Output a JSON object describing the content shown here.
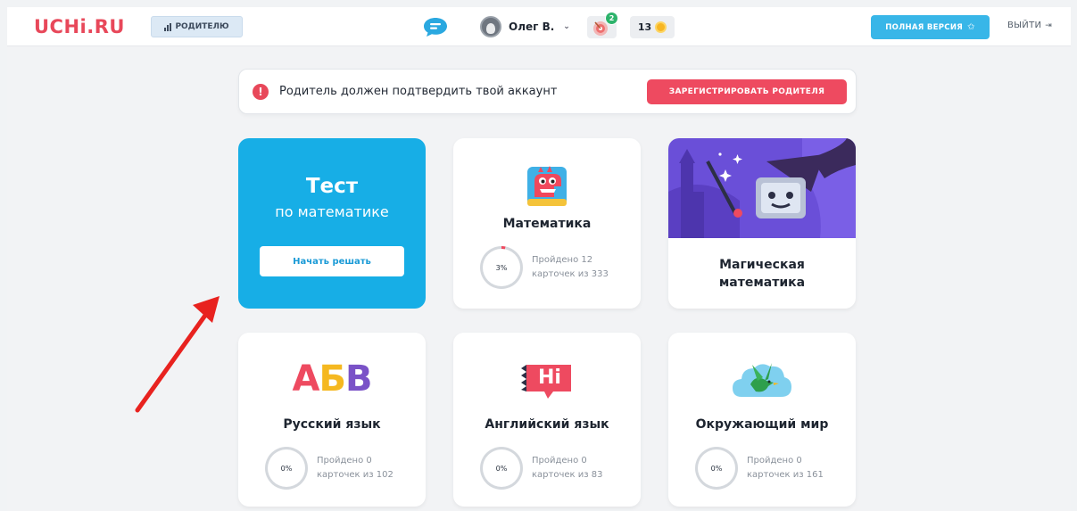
{
  "header": {
    "logo": "UCHi.RU",
    "parent_label": "РОДИТЕЛЮ",
    "user_name": "Олег В.",
    "notifications_count": "2",
    "coins": "13",
    "full_version_label": "ПОЛНАЯ ВЕРСИЯ",
    "logout_label": "ВЫЙТИ"
  },
  "alert": {
    "text": "Родитель должен подтвердить твой аккаунт",
    "button_label": "ЗАРЕГИСТРИРОВАТЬ РОДИТЕЛЯ"
  },
  "test_card": {
    "title": "Тест",
    "subtitle": "по математике",
    "button_label": "Начать решать"
  },
  "subjects": [
    {
      "title": "Математика",
      "percent_label": "3%",
      "percent": 3,
      "progress_line1": "Пройдено 12",
      "progress_line2": "карточек из 333"
    },
    {
      "title": "Русский язык",
      "percent_label": "0%",
      "percent": 0,
      "progress_line1": "Пройдено 0",
      "progress_line2": "карточек из 102"
    },
    {
      "title": "Английский язык",
      "percent_label": "0%",
      "percent": 0,
      "progress_line1": "Пройдено 0",
      "progress_line2": "карточек из 83"
    },
    {
      "title": "Окружающий мир",
      "percent_label": "0%",
      "percent": 0,
      "progress_line1": "Пройдено 0",
      "progress_line2": "карточек из 161"
    }
  ],
  "magic_card": {
    "title_line1": "Магическая",
    "title_line2": "математика"
  },
  "icons": {
    "rus_letters": [
      "А",
      "Б",
      "В"
    ],
    "eng_badge": "Hi"
  },
  "colors": {
    "brand_red": "#e8485a",
    "accent_blue": "#17aee6",
    "button_blue": "#38b6e8",
    "register_red": "#ee4a60",
    "progress_red": "#ee4a60",
    "arrow_red": "#e8221f"
  }
}
